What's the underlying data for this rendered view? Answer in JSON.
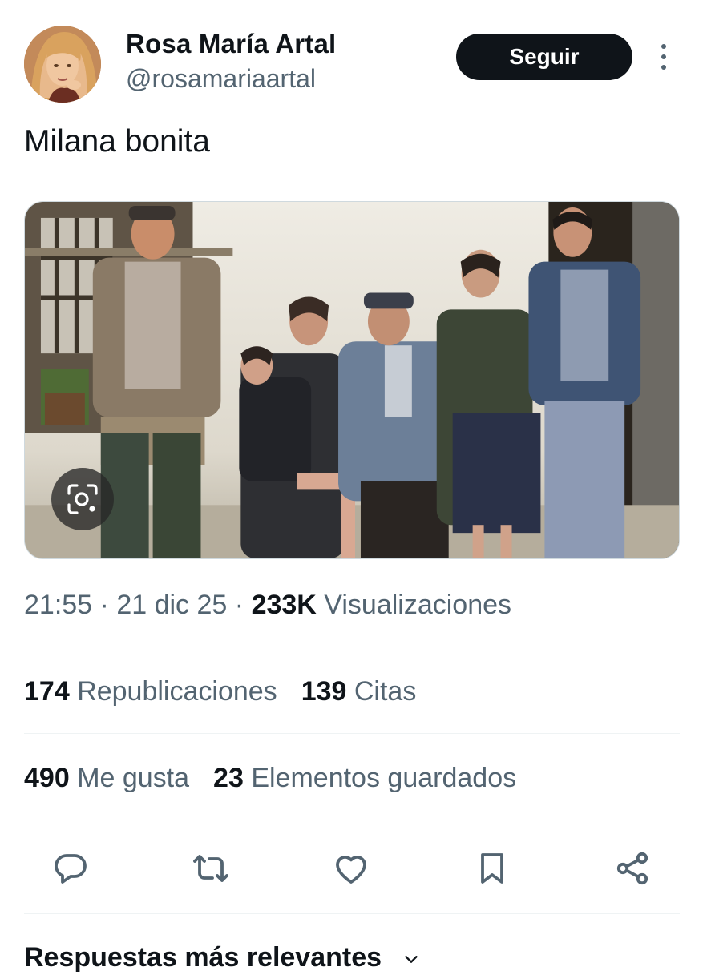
{
  "author": {
    "display_name": "Rosa María Artal",
    "handle": "@rosamariaartal"
  },
  "follow_label": "Seguir",
  "tweet_text": "Milana bonita",
  "meta": {
    "time": "21:55",
    "sep1": "·",
    "date": "21 dic 25",
    "sep2": "·",
    "views_count": "233K",
    "views_label": "Visualizaciones"
  },
  "stats": {
    "reposts_count": "174",
    "reposts_label": "Republicaciones",
    "quotes_count": "139",
    "quotes_label": "Citas",
    "likes_count": "490",
    "likes_label": "Me gusta",
    "bookmarks_count": "23",
    "bookmarks_label": "Elementos guardados"
  },
  "actions": [
    "reply-icon",
    "repost-icon",
    "like-icon",
    "bookmark-icon",
    "share-icon"
  ],
  "replies_header": "Respuestas más relevantes",
  "colors": {
    "text_primary": "#0f1419",
    "text_secondary": "#536471",
    "divider": "#eff3f4",
    "button_bg": "#0f1419"
  }
}
